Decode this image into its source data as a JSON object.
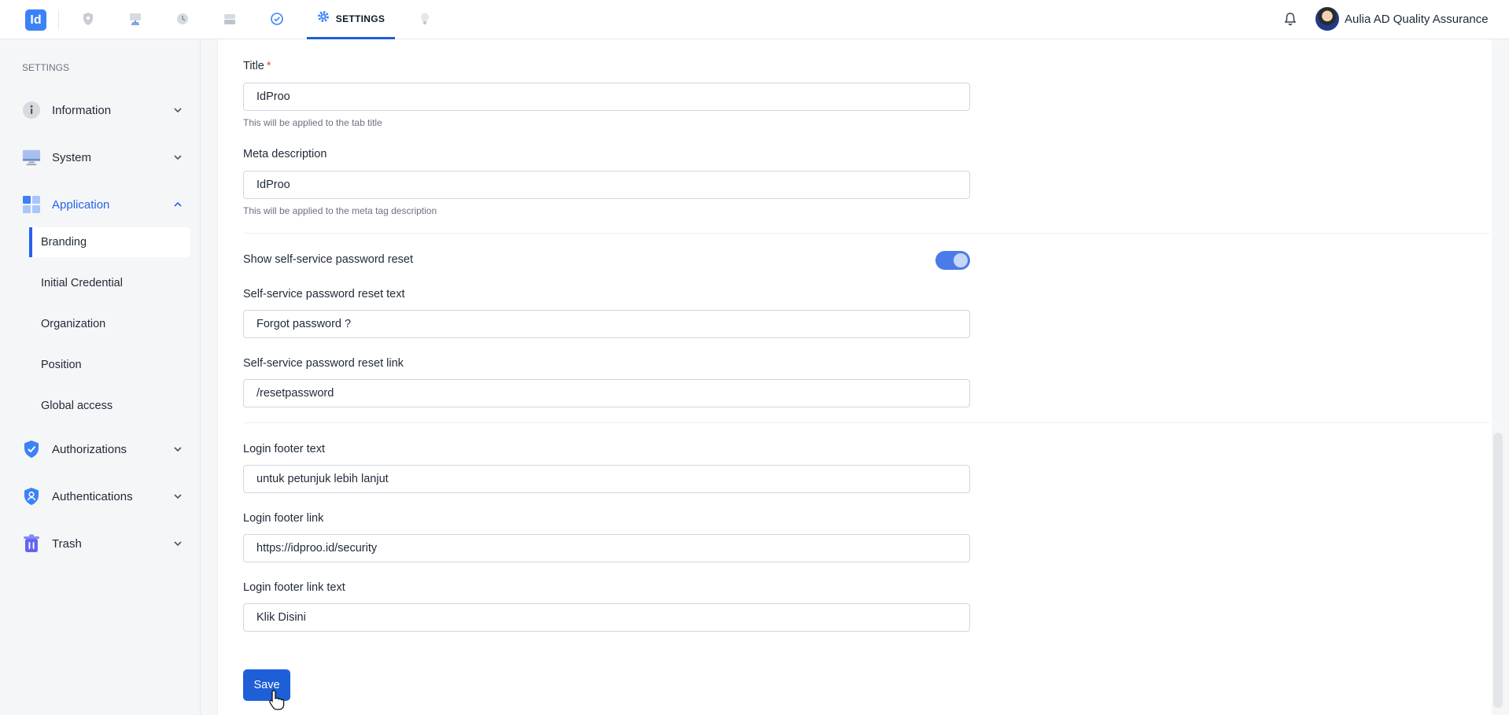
{
  "header": {
    "logo_text": "Id",
    "active_tab_label": "SETTINGS",
    "user_name": "Aulia AD Quality Assurance",
    "nav_icons": [
      "shield-icon",
      "desktop-icon",
      "history-icon",
      "drive-icon",
      "check-circle-icon",
      "gear-icon",
      "bulb-icon"
    ]
  },
  "sidebar": {
    "title": "SETTINGS",
    "groups": [
      {
        "label": "Information",
        "icon": "info-icon"
      },
      {
        "label": "System",
        "icon": "monitor-icon"
      },
      {
        "label": "Application",
        "icon": "grid-icon"
      },
      {
        "label": "Authorizations",
        "icon": "shield-check-icon"
      },
      {
        "label": "Authentications",
        "icon": "shield-user-icon"
      },
      {
        "label": "Trash",
        "icon": "trash-icon"
      }
    ],
    "sub_items": [
      {
        "label": "Branding"
      },
      {
        "label": "Initial Credential"
      },
      {
        "label": "Organization"
      },
      {
        "label": "Position"
      },
      {
        "label": "Global access"
      }
    ]
  },
  "form": {
    "title": {
      "label": "Title",
      "required": "*",
      "value": "IdProo",
      "help": "This will be applied to the tab title"
    },
    "meta": {
      "label": "Meta description",
      "value": "IdProo",
      "help": "This will be applied to the meta tag description"
    },
    "reset_toggle": {
      "label": "Show self-service password reset",
      "enabled": true
    },
    "reset_text": {
      "label": "Self-service password reset text",
      "value": "Forgot password ?"
    },
    "reset_link": {
      "label": "Self-service password reset link",
      "value": "/resetpassword"
    },
    "footer_text": {
      "label": "Login footer text",
      "value": "untuk petunjuk lebih lanjut"
    },
    "footer_link": {
      "label": "Login footer link",
      "value": "https://idproo.id/security"
    },
    "footer_link_text": {
      "label": "Login footer link text",
      "value": "Klik Disini"
    },
    "save_label": "Save"
  },
  "colors": {
    "accent": "#1d5fd6",
    "active_text": "#2563eb"
  }
}
